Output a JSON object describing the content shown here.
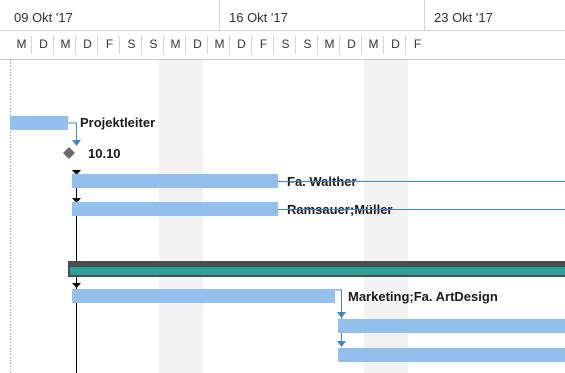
{
  "timescale": {
    "weeks": [
      {
        "label": "09 Okt '17"
      },
      {
        "label": "16 Okt '17"
      },
      {
        "label": "23 Okt '17"
      }
    ],
    "days": [
      "M",
      "D",
      "M",
      "D",
      "F",
      "S",
      "S",
      "M",
      "D",
      "M",
      "D",
      "F",
      "S",
      "S",
      "M",
      "D",
      "M",
      "D",
      "F"
    ]
  },
  "tasks": {
    "projektleiter": {
      "label": "Projektleiter"
    },
    "milestone": {
      "label": "10.10"
    },
    "walther": {
      "label": "Fa. Walther"
    },
    "ramsauer": {
      "label": "Ramsauer;Müller"
    },
    "marketing": {
      "label": "Marketing;Fa. ArtDesign"
    }
  },
  "colors": {
    "bar": "#92bfec",
    "summary": "#2aa198",
    "link": "#3f86d0",
    "weekend": "#f2f2f2"
  }
}
